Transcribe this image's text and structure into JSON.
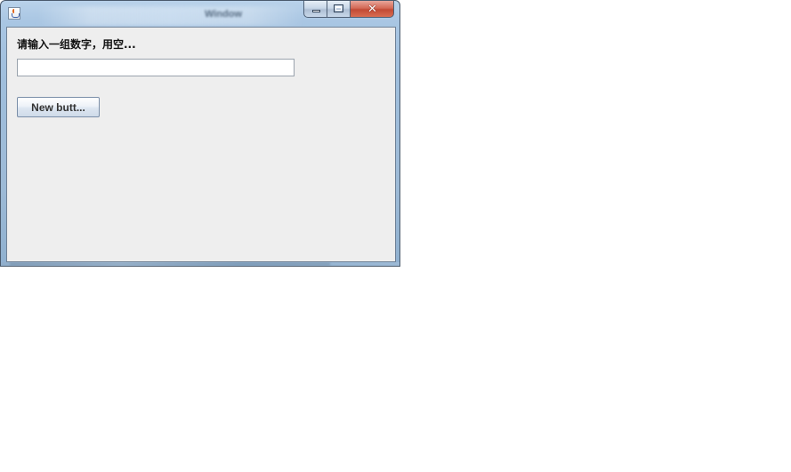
{
  "window": {
    "title": "Window",
    "icon": "java-cup-icon",
    "controls": {
      "minimize": "minimize-icon",
      "maximize": "maximize-icon",
      "close_glyph": "✕"
    }
  },
  "content": {
    "prompt_label": "请输入一组数字，用空...",
    "number_input": {
      "value": "",
      "placeholder": ""
    },
    "new_button_label": "New butt..."
  },
  "colors": {
    "content_background": "#eeeeee",
    "close_button": "#c24a35",
    "frame_glass": "#9fbedc"
  }
}
